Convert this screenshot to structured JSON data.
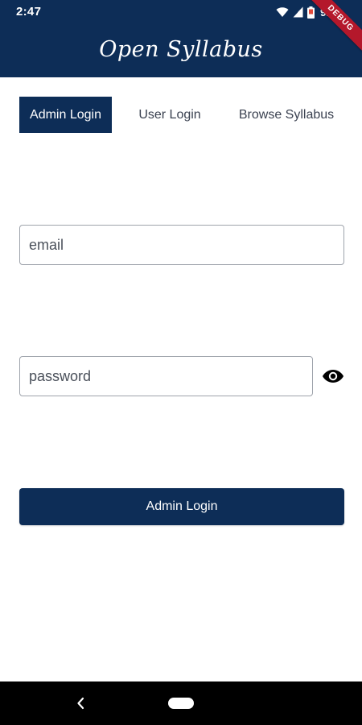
{
  "status_bar": {
    "time": "2:47",
    "battery": "92%",
    "icons": [
      "wifi-icon",
      "signal-icon",
      "battery-icon"
    ]
  },
  "debug_banner": "DEBUG",
  "app_bar": {
    "title": "Open Syllabus"
  },
  "tabs": [
    {
      "label": "Admin Login",
      "active": true
    },
    {
      "label": "User Login",
      "active": false
    },
    {
      "label": "Browse Syllabus",
      "active": false
    }
  ],
  "form": {
    "email_placeholder": "email",
    "email_value": "",
    "password_placeholder": "password",
    "password_value": "",
    "visibility_icon": "eye-icon",
    "submit_label": "Admin Login"
  },
  "nav_bar": {
    "icons": [
      "back-icon",
      "home-icon"
    ]
  },
  "colors": {
    "primary": "#0d2d57",
    "background": "#ffffff",
    "debug_banner": "#b4182b"
  }
}
